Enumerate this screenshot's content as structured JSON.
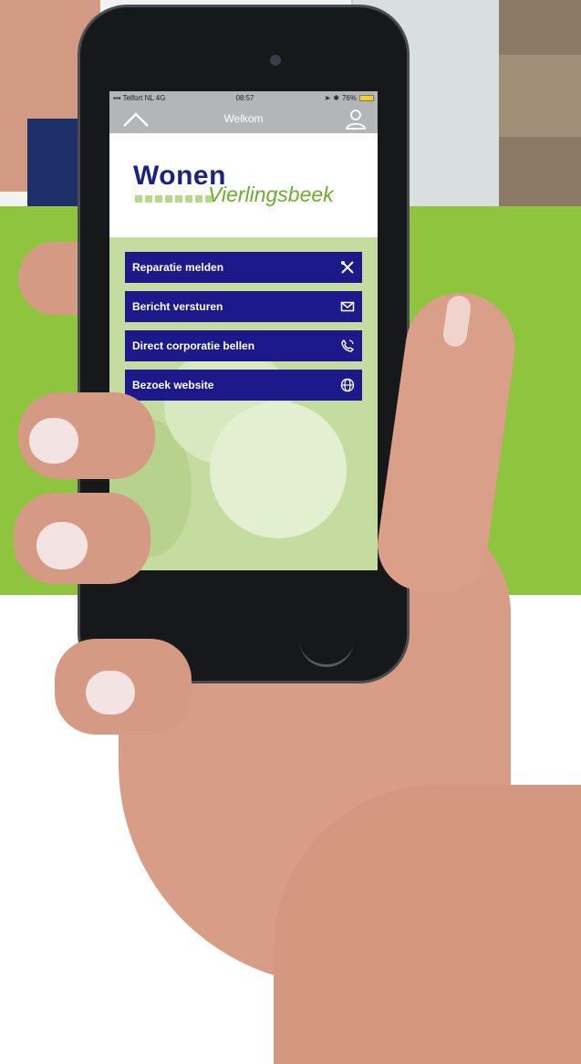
{
  "status_bar": {
    "carrier": "Telfort NL",
    "network": "4G",
    "time": "08:57",
    "battery": "76%"
  },
  "nav": {
    "title": "Welkom",
    "home_icon": "home-icon",
    "user_icon": "user-icon"
  },
  "logo": {
    "line1": "Wonen",
    "line2": "Vierlingsbeek"
  },
  "menu": {
    "items": [
      {
        "label": "Reparatie melden",
        "icon": "tools-icon"
      },
      {
        "label": "Bericht versturen",
        "icon": "mail-icon"
      },
      {
        "label": "Direct corporatie bellen",
        "icon": "phone-icon"
      },
      {
        "label": "Bezoek website",
        "icon": "globe-icon"
      }
    ]
  },
  "colors": {
    "brand_blue": "#1c1a8a",
    "brand_green": "#6dad2c",
    "background_green": "#8fc43e",
    "navbar_gray": "#b3b5b7"
  }
}
